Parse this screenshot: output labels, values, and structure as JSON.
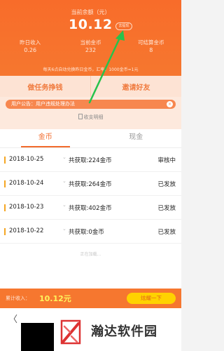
{
  "header": {
    "balance_label": "当前余额（元）",
    "balance_value": "10.12",
    "withdraw_label": "去提现",
    "stats": [
      {
        "label": "昨日收入",
        "value": "0.26"
      },
      {
        "label": "当前金币",
        "value": "232"
      },
      {
        "label": "可结算金币",
        "value": "8"
      }
    ],
    "exchange_notice": "每天6点自动兑换昨日金币，汇率：1000金币=1元"
  },
  "actions": {
    "tasks": "做任务挣钱",
    "invite": "邀请好友"
  },
  "announcement": {
    "text": "用户公告：用户违规处理办法",
    "close": "×"
  },
  "rules_label": "收支明细",
  "tabs": {
    "coins": "金币",
    "cash": "现金"
  },
  "records": [
    {
      "date": "2018-10-25",
      "amount": "共获取:224金币",
      "status": "审核中"
    },
    {
      "date": "2018-10-24",
      "amount": "共获取:264金币",
      "status": "已发放"
    },
    {
      "date": "2018-10-23",
      "amount": "共获取:402金币",
      "status": "已发放"
    },
    {
      "date": "2018-10-22",
      "amount": "共获取:0金币",
      "status": "已发放"
    }
  ],
  "loading": "正在加载...",
  "summary": {
    "label": "累计收入：",
    "value": "10.12元",
    "button": "炫耀一下"
  },
  "nav": {
    "back": "〈"
  },
  "watermark": {
    "text": "瀚达软件园"
  },
  "colors": {
    "brand_orange": "#f6772f",
    "arrow_green": "#27c24c",
    "record_bar": "#f5a623"
  }
}
